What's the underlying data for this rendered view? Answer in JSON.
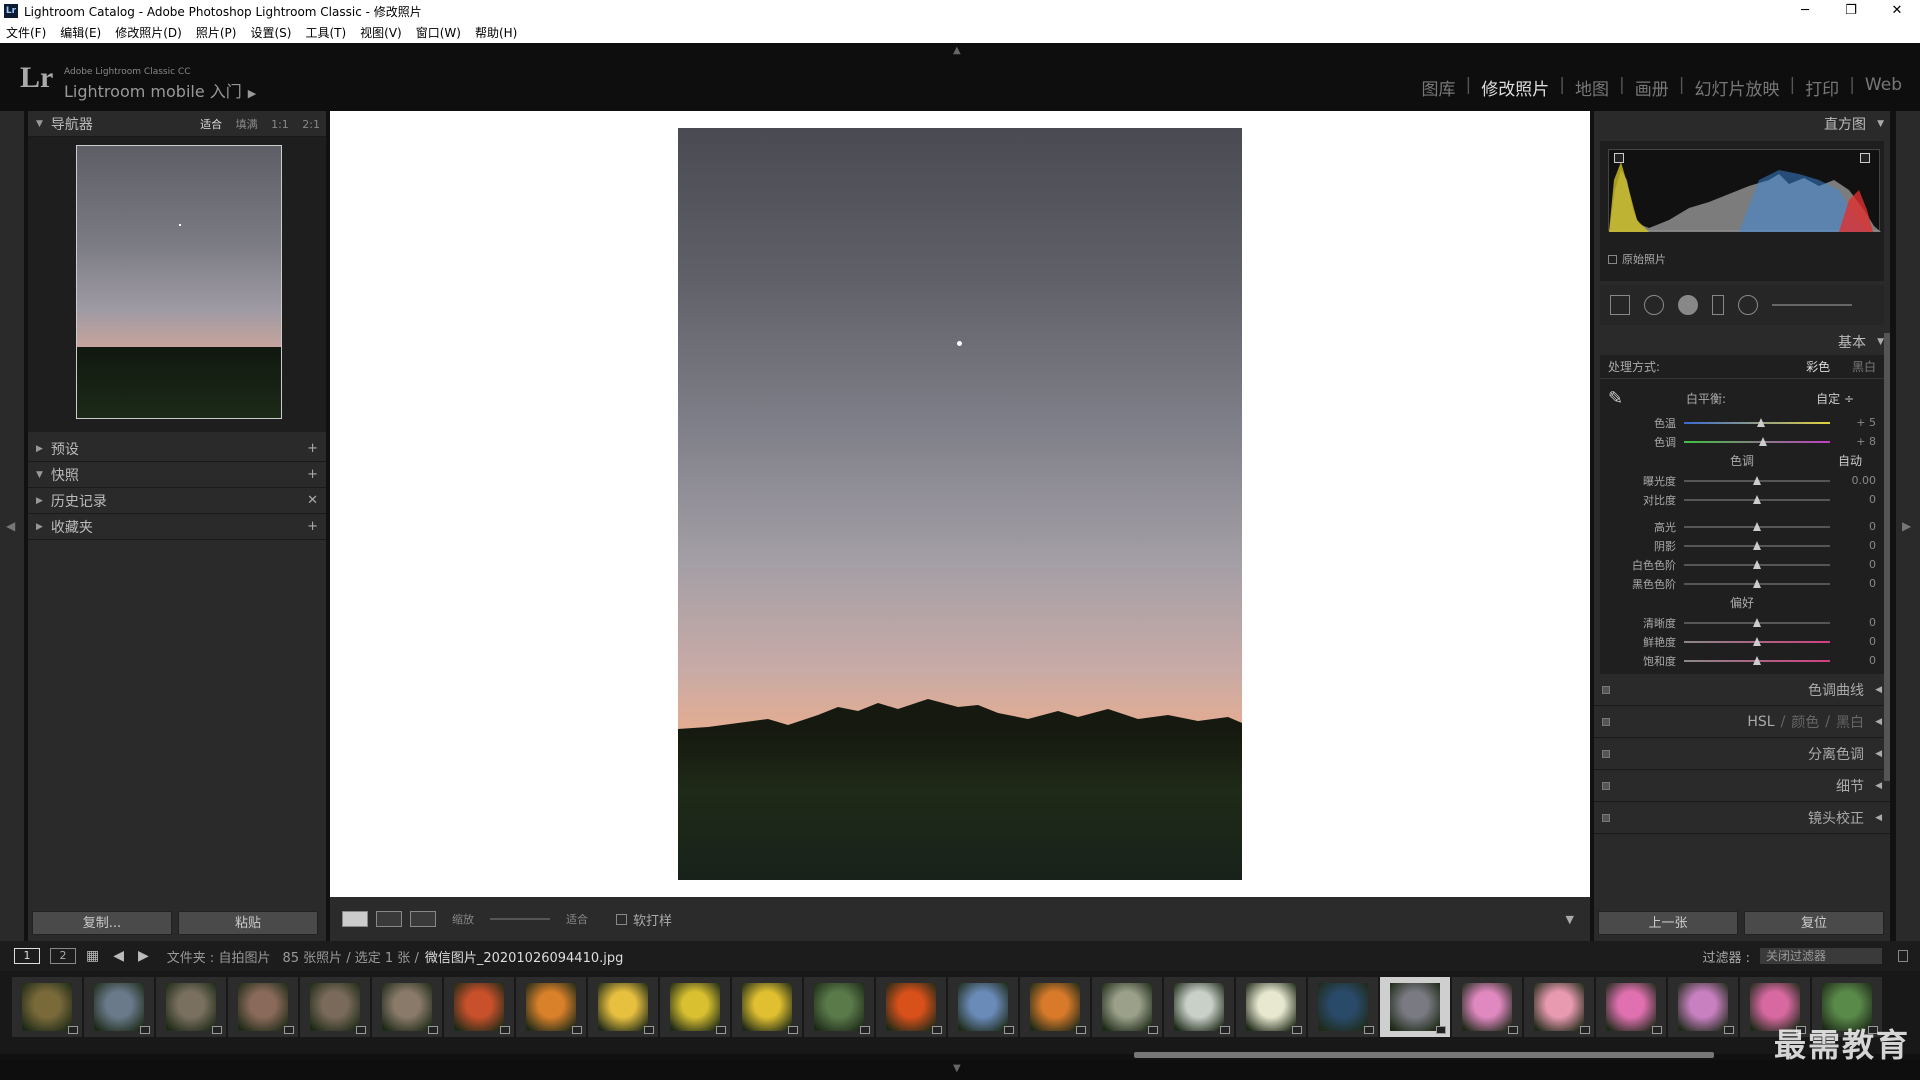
{
  "window": {
    "title": "Lightroom Catalog - Adobe Photoshop Lightroom Classic - 修改照片",
    "app_icon": "Lr",
    "min": "─",
    "max": "❐",
    "close": "✕"
  },
  "menu": [
    "文件(F)",
    "编辑(E)",
    "修改照片(D)",
    "照片(P)",
    "设置(S)",
    "工具(T)",
    "视图(V)",
    "窗口(W)",
    "帮助(H)"
  ],
  "identity": {
    "logo": "Lr",
    "product": "Adobe Lightroom Classic CC",
    "mobile": "Lightroom mobile 入门",
    "play": "▶"
  },
  "modules": [
    {
      "label": "图库",
      "active": false
    },
    {
      "label": "修改照片",
      "active": true
    },
    {
      "label": "地图",
      "active": false
    },
    {
      "label": "画册",
      "active": false
    },
    {
      "label": "幻灯片放映",
      "active": false
    },
    {
      "label": "打印",
      "active": false
    },
    {
      "label": "Web",
      "active": false
    }
  ],
  "left": {
    "navigator": {
      "title": "导航器",
      "options": [
        "适合",
        "填满",
        "1:1",
        "2:1"
      ],
      "selected": "适合"
    },
    "panels": [
      {
        "title": "预设",
        "action": "+",
        "open": false
      },
      {
        "title": "快照",
        "action": "+",
        "open": true
      },
      {
        "title": "历史记录",
        "action": "✕",
        "open": false
      },
      {
        "title": "收藏夹",
        "action": "+",
        "open": false
      }
    ],
    "copy_label": "复制...",
    "paste_label": "粘贴"
  },
  "toolbar": {
    "zoom_label": "缩放",
    "fit_label": "适合",
    "softproof_label": "软打样"
  },
  "right": {
    "histogram_title": "直方图",
    "original_photo": "原始照片",
    "basic_title": "基本",
    "treatment_label": "处理方式:",
    "treatment_color": "彩色",
    "treatment_bw": "黑白",
    "wb_label": "白平衡:",
    "wb_value": "自定 ÷",
    "wb_sliders": [
      {
        "label": "色温",
        "value": "+ 5",
        "pos": 0.53
      },
      {
        "label": "色调",
        "value": "+ 8",
        "pos": 0.54
      }
    ],
    "tone_title": "色调",
    "auto_label": "自动",
    "tone_sliders": [
      {
        "label": "曝光度",
        "value": "0.00",
        "pos": 0.5
      },
      {
        "label": "对比度",
        "value": "0",
        "pos": 0.5
      }
    ],
    "tone_sliders2": [
      {
        "label": "高光",
        "value": "0",
        "pos": 0.5
      },
      {
        "label": "阴影",
        "value": "0",
        "pos": 0.5
      },
      {
        "label": "白色色阶",
        "value": "0",
        "pos": 0.5
      },
      {
        "label": "黑色色阶",
        "value": "0",
        "pos": 0.5
      }
    ],
    "presence_title": "偏好",
    "presence_sliders": [
      {
        "label": "清晰度",
        "value": "0",
        "pos": 0.5
      },
      {
        "label": "鲜艳度",
        "value": "0",
        "pos": 0.5
      },
      {
        "label": "饱和度",
        "value": "0",
        "pos": 0.5
      }
    ],
    "sections": {
      "tone_curve": "色调曲线",
      "hsl": "HSL",
      "hsl_color": "颜色",
      "hsl_bw": "黑白",
      "split": "分离色调",
      "detail": "细节",
      "lens": "镜头校正"
    },
    "prev_label": "上一张",
    "reset_label": "复位"
  },
  "filmbar": {
    "page1": "1",
    "page2": "2",
    "folder": "文件夹 : 自拍图片",
    "count": "85 张照片 / 选定 1 张 /",
    "filename": "微信图片_20201026094410.jpg",
    "filter_label": "过滤器 :",
    "filter_value": "关闭过滤器"
  },
  "filmstrip_colors": [
    "#7a6a3a",
    "#6a7a8a",
    "#7a7060",
    "#8a6a5a",
    "#7a6a5a",
    "#8a7a6a",
    "#c8502a",
    "#d8802a",
    "#e8c040",
    "#d8c030",
    "#e0c030",
    "#5a7a4a",
    "#d8501a",
    "#6a8ab8",
    "#d87a2a",
    "#9aa08a",
    "#c8d0c8",
    "#e8e8d0",
    "#2a4a6a",
    "#7a7a82",
    "#e088c0",
    "#e89ab0",
    "#e070b0",
    "#c880c0",
    "#d868a0",
    "#5a8a4a"
  ],
  "selected_index": 19,
  "watermark": "最需教育"
}
